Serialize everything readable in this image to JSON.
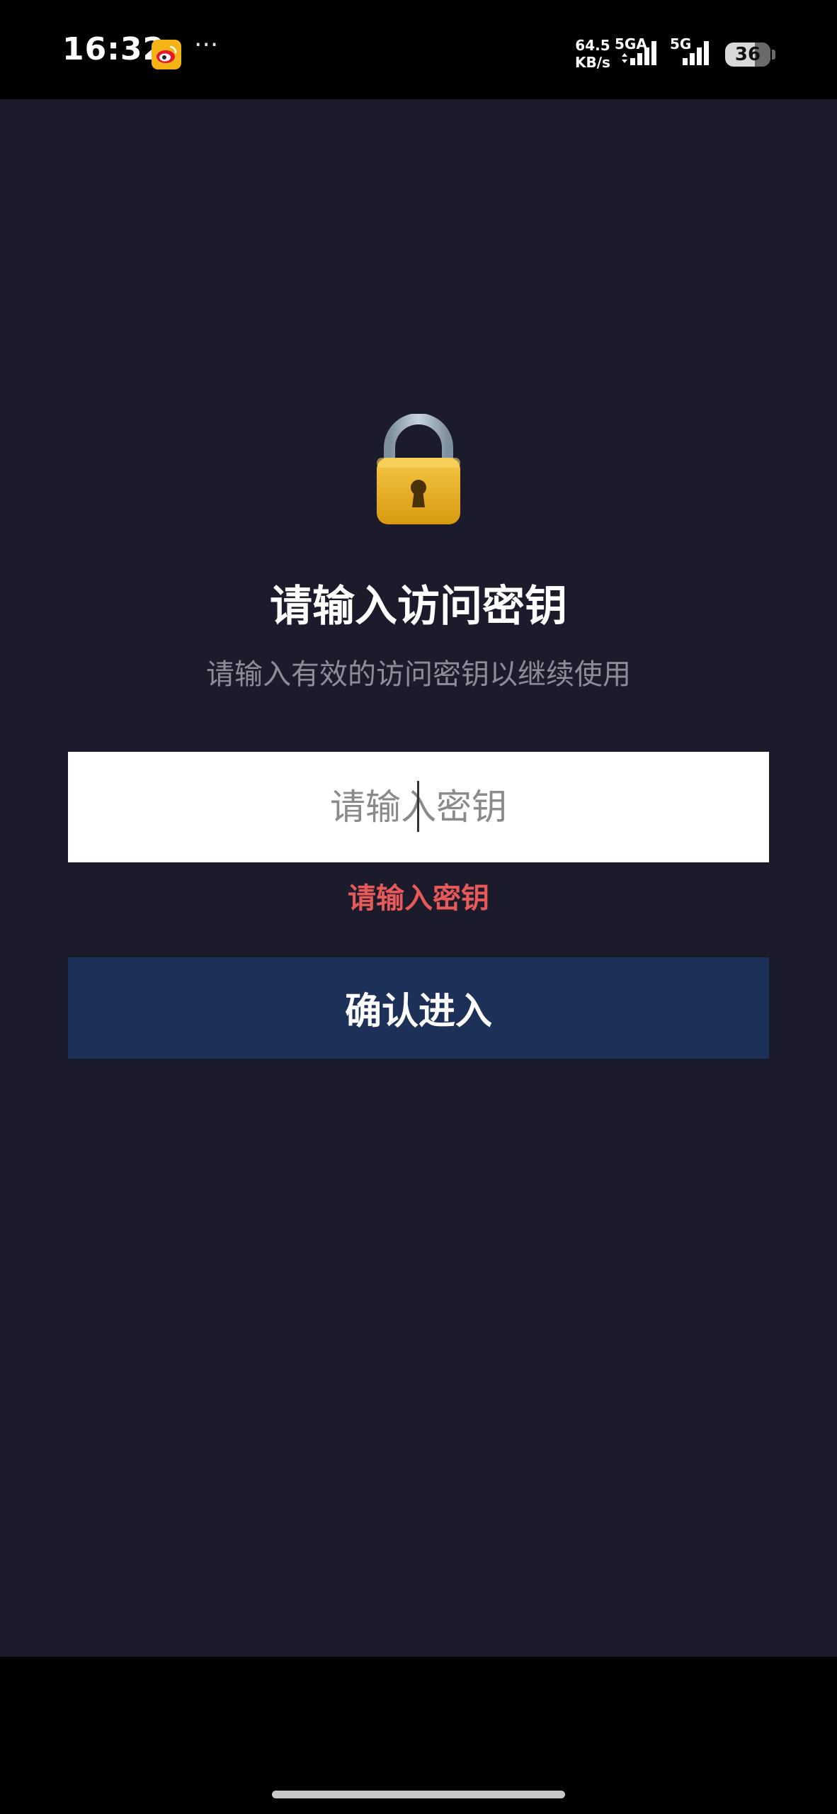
{
  "status_bar": {
    "time": "16:32",
    "more_indicator": "···",
    "net_speed_value": "64.5",
    "net_speed_unit": "KB/s",
    "sim1_label": "5GA",
    "sim2_label": "5G",
    "battery_level": "36",
    "icons": [
      "weibo-icon",
      "more-dots-icon",
      "signal-icon",
      "battery-icon"
    ]
  },
  "auth": {
    "icon": "lock-icon",
    "title": "请输入访问密钥",
    "subtitle": "请输入有效的访问密钥以继续使用",
    "input_placeholder": "请输入密钥",
    "input_value": "",
    "error_message": "请输入密钥",
    "confirm_label": "确认进入"
  },
  "colors": {
    "background": "#1b1b2c",
    "status_bar": "#000000",
    "input_background": "#ffffff",
    "error_text": "#e85a5a",
    "button_background": "#1c3058",
    "button_text": "#ffffff",
    "subtitle_text": "#8d8d99"
  }
}
